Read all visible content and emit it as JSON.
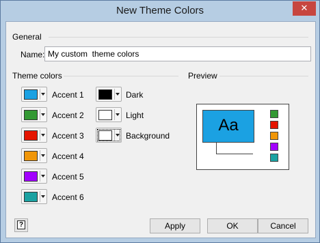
{
  "window": {
    "title": "New Theme Colors",
    "close_label": "✕"
  },
  "general": {
    "section_label": "General",
    "name_label": "Name:",
    "name_value": "My custom  theme colors"
  },
  "theme_colors": {
    "section_label": "Theme colors",
    "accents": [
      {
        "label": "Accent 1",
        "color": "#1ba1e2"
      },
      {
        "label": "Accent 2",
        "color": "#339933"
      },
      {
        "label": "Accent 3",
        "color": "#e51400"
      },
      {
        "label": "Accent 4",
        "color": "#f09609"
      },
      {
        "label": "Accent 5",
        "color": "#a200ff"
      },
      {
        "label": "Accent 6",
        "color": "#1ba2a2"
      }
    ],
    "base": [
      {
        "label": "Dark",
        "color": "#000000"
      },
      {
        "label": "Light",
        "color": "#ffffff"
      },
      {
        "label": "Background",
        "color": "#ffffff"
      }
    ]
  },
  "preview": {
    "section_label": "Preview",
    "sample_text": "Aa"
  },
  "buttons": {
    "apply": "Apply",
    "ok": "OK",
    "cancel": "Cancel",
    "help_glyph": "?"
  }
}
